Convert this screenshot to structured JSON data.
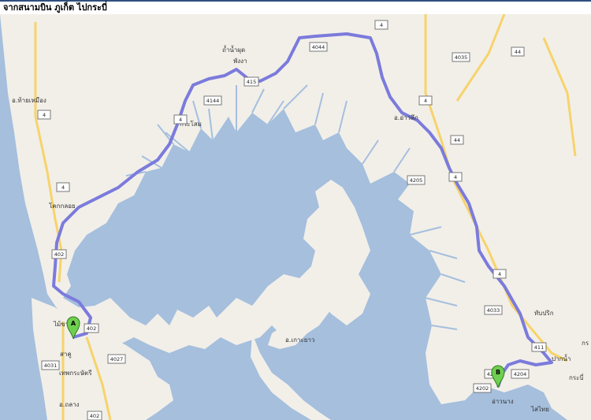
{
  "title": "จากสนามบิน ภูเก็ต ไปกระบี่",
  "colors": {
    "water": "#a5bfdd",
    "land": "#f2efe9",
    "route": "#7b7bdc",
    "highway": "#f7d36a",
    "marker": "#6fcf4f"
  },
  "markers": {
    "start": "A",
    "end": "B"
  },
  "places": {
    "thai_mueang": "อ.ท้ายเหมือง",
    "khok_kloi": "โคกกลอย",
    "mai_khao": "ไม้ขาว",
    "sakhu": "สาคู",
    "thep_krasattri": "เทพกระษัตรี",
    "thalang": "อ.ถลาง",
    "tham_nam_phut": "ถ้ำน้ำผุด",
    "phang_nga": "พังงา",
    "kraso": "กระโสม",
    "koh_yao": "อ.เกาะยาว",
    "ao_luek": "อ.อ่าวลึก",
    "thap_prik": "ทับปริก",
    "pak_nam": "ปากน้ำ",
    "krabi": "กระบี่",
    "ao_nang": "อ่าวนาง",
    "sai_thai": "ไสไทย",
    "krabi_edge": "กร"
  },
  "shields": [
    "4",
    "4",
    "4",
    "402",
    "402",
    "4027",
    "4031",
    "4144",
    "4044",
    "415",
    "4",
    "4035",
    "44",
    "4",
    "44",
    "4205",
    "4",
    "4",
    "4033",
    "411",
    "4203",
    "4204",
    "4202",
    "402"
  ]
}
